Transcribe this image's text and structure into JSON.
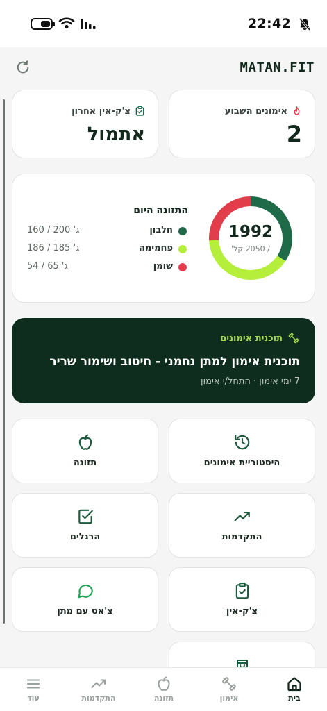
{
  "status_bar": {
    "time": "22:42"
  },
  "app": {
    "brand": "MATAN.FIT"
  },
  "stats": {
    "workouts_week_label": "אימונים השבוע",
    "workouts_week_value": "2",
    "last_checkin_label": "צ'ק-אין אחרון",
    "last_checkin_value": "אתמול"
  },
  "nutrition": {
    "title": "התזונה היום",
    "calories": "1992",
    "calories_target": "/ 2050 קל'",
    "calories_consumed_value": 1992,
    "calories_target_value": 2050,
    "macros": [
      {
        "name": "חלבון",
        "value": "ג' 200 / 160",
        "color": "#1f6b49"
      },
      {
        "name": "פחמימה",
        "value": "ג' 185 / 186",
        "color": "#b5ef3b"
      },
      {
        "name": "שומן",
        "value": "ג' 65 / 54",
        "color": "#e23d4b"
      }
    ],
    "ring_colors": {
      "protein": "#1f6b49",
      "carbs": "#b5ef3b",
      "fat": "#e23d4b",
      "track": "#eef0ee"
    }
  },
  "training_plan": {
    "label": "תוכנית אימונים",
    "title": "תוכנית אימון למתן נחמני - חיטוב ושימור שריר",
    "subtitle": "7 ימי אימון · התחל/י אימון"
  },
  "tiles": {
    "history": "היסטוריית אימונים",
    "nutrition": "תזונה",
    "progress": "התקדמות",
    "habits": "הרגלים",
    "checkin": "צ'ק-אין",
    "chat": "צ'אט עם מתן"
  },
  "nav": {
    "home": "בית",
    "workout": "אימון",
    "nutrition": "תזונה",
    "progress": "התקדמות",
    "more": "עוד"
  },
  "colors": {
    "brand_dark": "#0f2d1e",
    "accent_green": "#1f6b49",
    "accent_lime": "#a3d94c"
  }
}
